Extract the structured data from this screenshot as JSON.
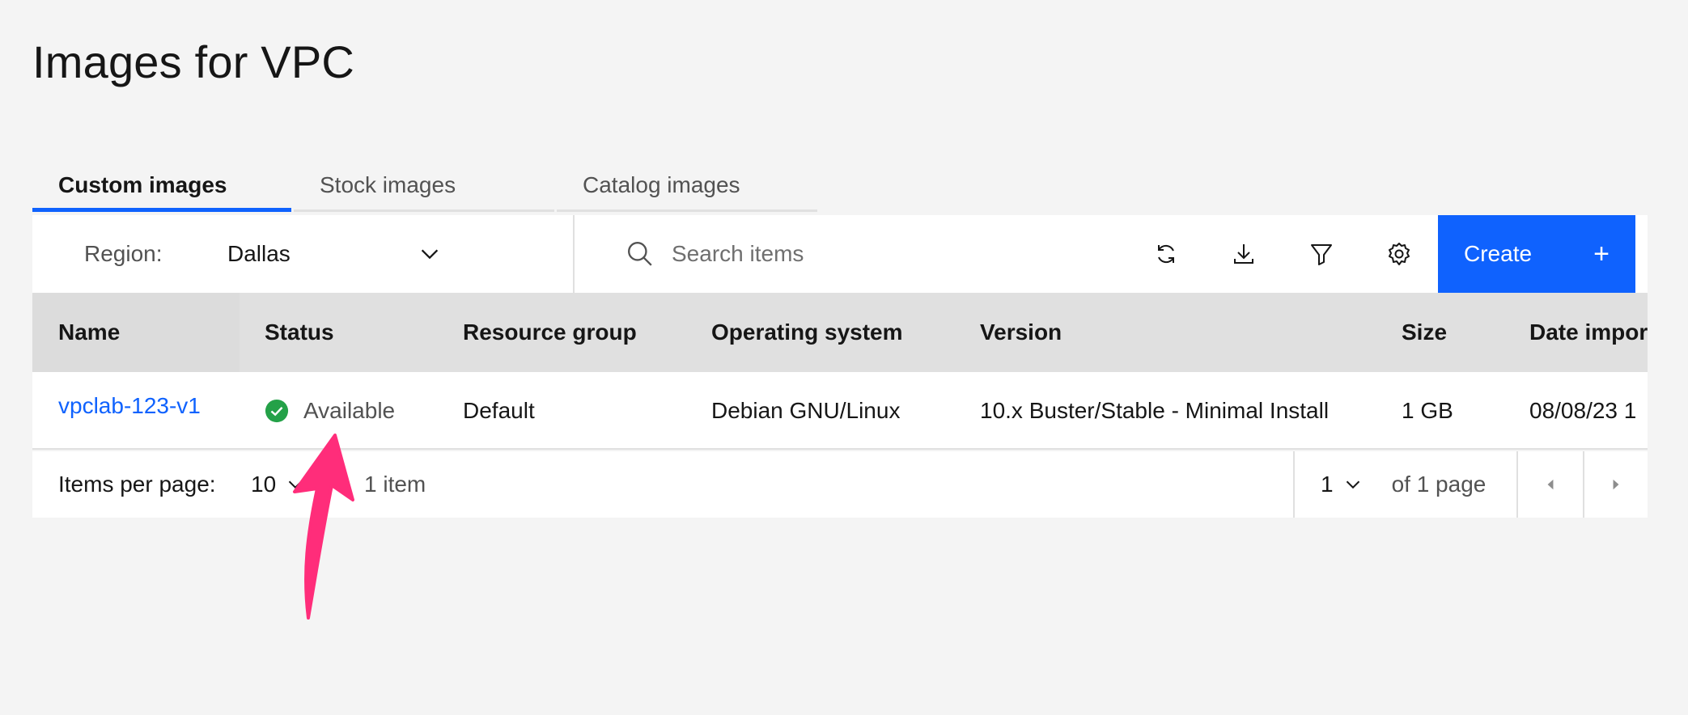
{
  "page": {
    "title": "Images for VPC"
  },
  "tabs": [
    {
      "label": "Custom images",
      "active": true
    },
    {
      "label": "Stock images",
      "active": false
    },
    {
      "label": "Catalog images",
      "active": false
    }
  ],
  "toolbar": {
    "region_label": "Region:",
    "region_value": "Dallas",
    "search_placeholder": "Search items",
    "icons": [
      "refresh-icon",
      "download-icon",
      "filter-icon",
      "settings-icon"
    ],
    "create_label": "Create",
    "create_icon": "+"
  },
  "table": {
    "headers": [
      "Name",
      "Status",
      "Resource group",
      "Operating system",
      "Version",
      "Size",
      "Date imported"
    ],
    "rows": [
      {
        "name": "vpclab-123-v1",
        "status": "Available",
        "resource_group": "Default",
        "os": "Debian GNU/Linux",
        "version": "10.x Buster/Stable - Minimal Install",
        "size": "1 GB",
        "date": "08/08/23 1"
      }
    ]
  },
  "pagination": {
    "items_per_page_label": "Items per page:",
    "items_per_page": "10",
    "item_count": "1 item",
    "page": "1",
    "of_pages": "of 1 page"
  },
  "colors": {
    "accent": "#0f62fe",
    "status_ok": "#24a148",
    "annotation": "#ff2d7a",
    "background": "#f4f4f4"
  }
}
